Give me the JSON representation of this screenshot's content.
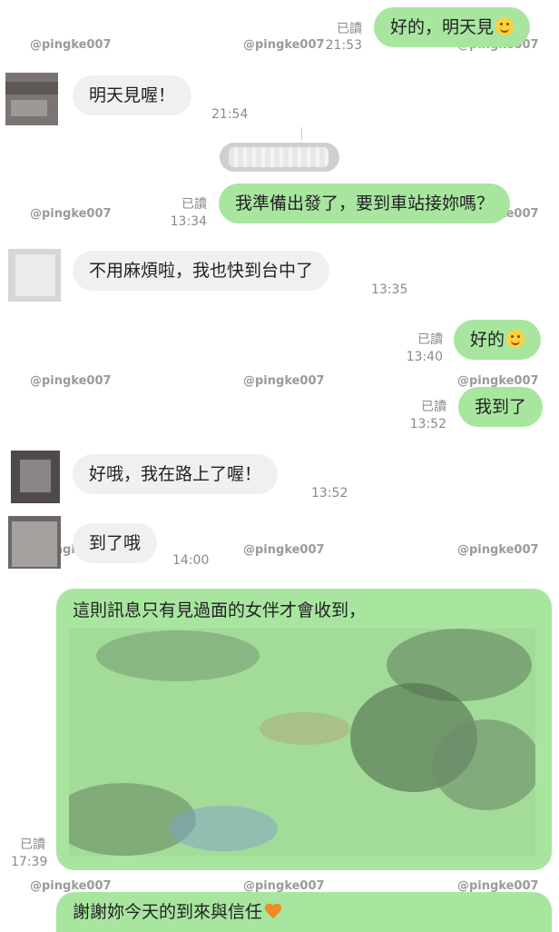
{
  "watermark": "@pingke007",
  "messages": [
    {
      "id": "m1",
      "dir": "out",
      "text": "好的，明天見",
      "emoji": "smile-emoji",
      "status": "已讀",
      "time": "21:53"
    },
    {
      "id": "m2",
      "dir": "in",
      "text": "明天見喔！",
      "time": "21:54"
    },
    {
      "id": "m3",
      "dir": "out",
      "text": "我準備出發了，要到車站接妳嗎？",
      "status": "已讀",
      "time": "13:34"
    },
    {
      "id": "m4",
      "dir": "in",
      "text": "不用麻煩啦，我也快到台中了",
      "time": "13:35"
    },
    {
      "id": "m5",
      "dir": "out",
      "text": "好的",
      "emoji": "smile-emoji",
      "status": "已讀",
      "time": "13:40"
    },
    {
      "id": "m6",
      "dir": "out",
      "text": "我到了",
      "status": "已讀",
      "time": "13:52"
    },
    {
      "id": "m7",
      "dir": "in",
      "text": "好哦，我在路上了喔！",
      "time": "13:52"
    },
    {
      "id": "m8",
      "dir": "in",
      "text": "到了哦",
      "time": "14:00"
    },
    {
      "id": "m9",
      "dir": "out",
      "text": "這則訊息只有見過面的女伴才會收到，",
      "status": "已讀",
      "time": "17:39"
    },
    {
      "id": "m10",
      "dir": "out",
      "text": "謝謝妳今天的到來與信任",
      "emoji": "orange-heart-emoji"
    }
  ],
  "colors": {
    "outgoing_bubble": "#a8e6a0",
    "incoming_bubble": "#eef0f2",
    "meta_text": "#8a8a8a"
  }
}
